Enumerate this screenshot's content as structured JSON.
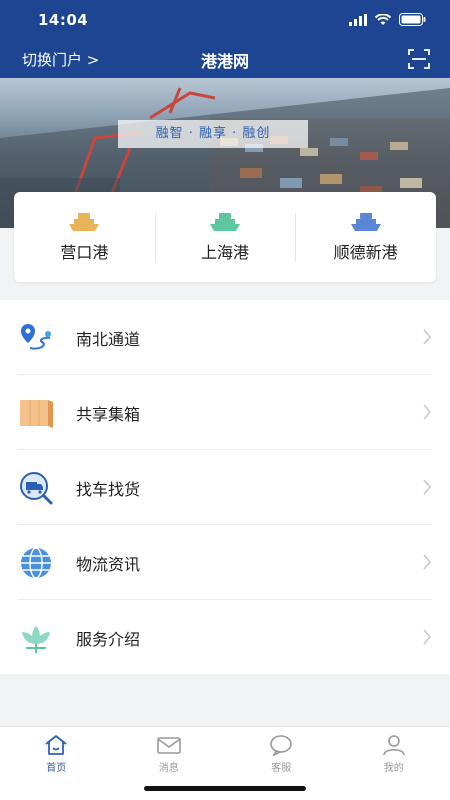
{
  "status_bar": {
    "time": "14:04"
  },
  "nav": {
    "switch_portal": "切换门户 >",
    "title": "港港网",
    "scan_icon": "scan-icon"
  },
  "banner": {
    "slogan": "融智 · 融享 · 融创"
  },
  "ports": [
    {
      "label": "营口港",
      "icon": "ship-icon",
      "color": "#e7b45a"
    },
    {
      "label": "上海港",
      "icon": "ship-icon",
      "color": "#5ec7a0"
    },
    {
      "label": "顺德新港",
      "icon": "ship-icon",
      "color": "#5b86d6"
    }
  ],
  "menu": [
    {
      "label": "南北通道",
      "icon": "route-pin-icon"
    },
    {
      "label": "共享集箱",
      "icon": "container-icon"
    },
    {
      "label": "找车找货",
      "icon": "truck-search-icon"
    },
    {
      "label": "物流资讯",
      "icon": "globe-icon"
    },
    {
      "label": "服务介绍",
      "icon": "lotus-icon"
    }
  ],
  "tabs": [
    {
      "label": "首页",
      "icon": "home-icon",
      "active": true
    },
    {
      "label": "消息",
      "icon": "mail-icon",
      "active": false
    },
    {
      "label": "客服",
      "icon": "chat-icon",
      "active": false
    },
    {
      "label": "我的",
      "icon": "user-icon",
      "active": false
    }
  ],
  "colors": {
    "primary": "#1d4592",
    "accent": "#2f5fb3"
  }
}
